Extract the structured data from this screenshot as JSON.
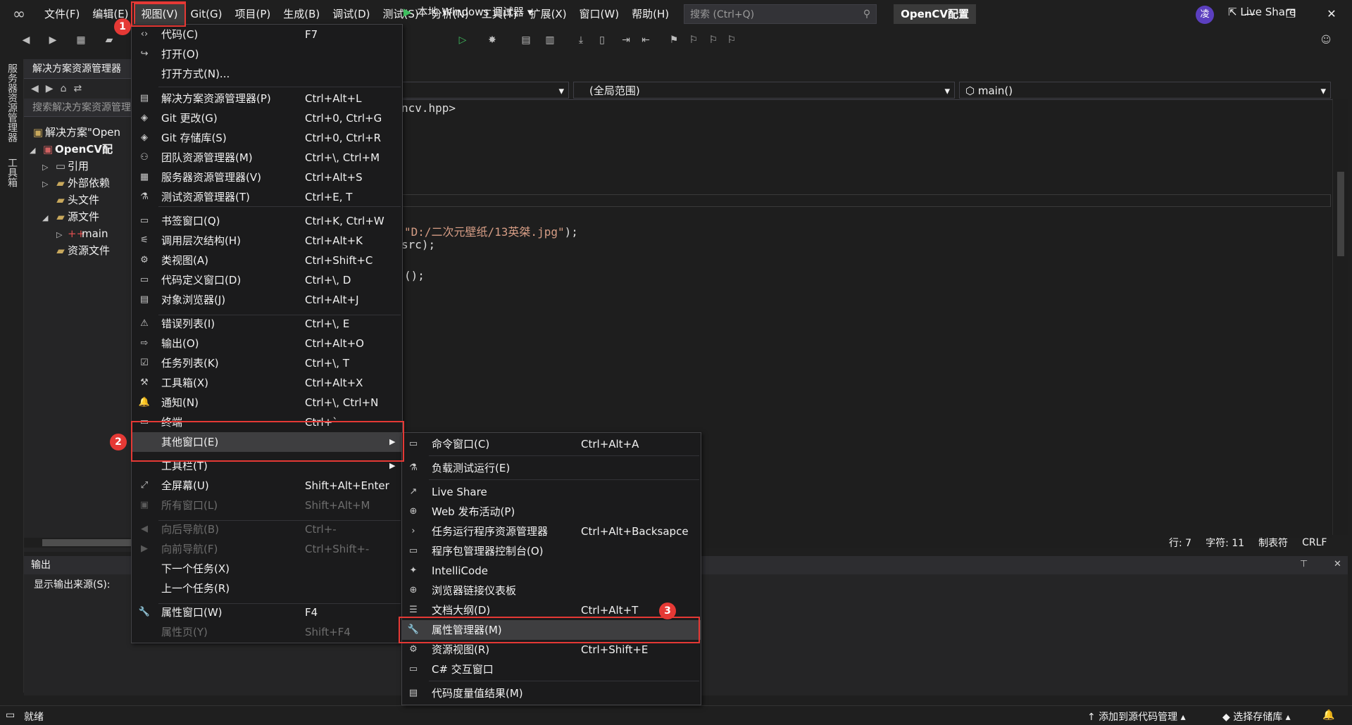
{
  "menubar": {
    "items": [
      "文件(F)",
      "编辑(E)",
      "视图(V)",
      "Git(G)",
      "项目(P)",
      "生成(B)",
      "调试(D)",
      "测试(S)",
      "分析(N)",
      "工具(T)",
      "扩展(X)",
      "窗口(W)",
      "帮助(H)"
    ],
    "search_placeholder": "搜索 (Ctrl+Q)",
    "project_name": "OpenCV配置",
    "avatar_initial": "凌"
  },
  "toolbar": {
    "debugger_label": "本地 Windows 调试器",
    "live_share": "Live Share"
  },
  "left_strip": {
    "tab1": "服务器资源管理器",
    "tab2": "工具箱"
  },
  "solution_explorer": {
    "title": "解决方案资源管理器",
    "search_placeholder": "搜索解决方案资源管理",
    "tree": [
      {
        "label": "解决方案\"Open",
        "bold": false
      },
      {
        "label": "OpenCV配",
        "bold": true
      },
      {
        "label": "引用",
        "bold": false
      },
      {
        "label": "外部依赖",
        "bold": false
      },
      {
        "label": "头文件",
        "bold": false
      },
      {
        "label": "源文件",
        "bold": false
      },
      {
        "label": "main",
        "bold": false
      },
      {
        "label": "资源文件",
        "bold": false
      }
    ]
  },
  "editor": {
    "scope_dropdown": "(全局范围)",
    "function_dropdown": "main()",
    "lines": [
      {
        "pre": "ncv.hpp>",
        "str": "",
        "post": ""
      },
      {
        "pre": "",
        "str": "\"D:/二次元壁纸/13英桀.jpg\"",
        "post": ");"
      },
      {
        "pre": "src);",
        "str": "",
        "post": ""
      },
      {
        "pre": "();",
        "str": "",
        "post": ""
      }
    ]
  },
  "status": {
    "line": "行: 7",
    "char": "字符: 11",
    "tab": "制表符",
    "eol": "CRLF",
    "ready": "就绪",
    "add_source": "添加到源代码管理",
    "select_repo": "选择存储库"
  },
  "output": {
    "title": "输出",
    "source_label": "显示输出来源(S):"
  },
  "view_menu": {
    "items": [
      {
        "icon": "‹›",
        "label": "代码(C)",
        "key": "F7",
        "disabled": false
      },
      {
        "icon": "↪",
        "label": "打开(O)",
        "key": "",
        "disabled": false
      },
      {
        "icon": "",
        "label": "打开方式(N)...",
        "key": "",
        "disabled": false
      },
      {
        "icon": "▤",
        "label": "解决方案资源管理器(P)",
        "key": "Ctrl+Alt+L",
        "disabled": false
      },
      {
        "icon": "◈",
        "label": "Git 更改(G)",
        "key": "Ctrl+0, Ctrl+G",
        "disabled": false
      },
      {
        "icon": "◈",
        "label": "Git 存储库(S)",
        "key": "Ctrl+0, Ctrl+R",
        "disabled": false
      },
      {
        "icon": "⚇",
        "label": "团队资源管理器(M)",
        "key": "Ctrl+\\, Ctrl+M",
        "disabled": false
      },
      {
        "icon": "▦",
        "label": "服务器资源管理器(V)",
        "key": "Ctrl+Alt+S",
        "disabled": false
      },
      {
        "icon": "⚗",
        "label": "测试资源管理器(T)",
        "key": "Ctrl+E, T",
        "disabled": false
      },
      {
        "icon": "▭",
        "label": "书签窗口(Q)",
        "key": "Ctrl+K, Ctrl+W",
        "disabled": false
      },
      {
        "icon": "⚟",
        "label": "调用层次结构(H)",
        "key": "Ctrl+Alt+K",
        "disabled": false
      },
      {
        "icon": "⚙",
        "label": "类视图(A)",
        "key": "Ctrl+Shift+C",
        "disabled": false
      },
      {
        "icon": "▭",
        "label": "代码定义窗口(D)",
        "key": "Ctrl+\\, D",
        "disabled": false
      },
      {
        "icon": "▤",
        "label": "对象浏览器(J)",
        "key": "Ctrl+Alt+J",
        "disabled": false
      },
      {
        "icon": "⚠",
        "label": "错误列表(I)",
        "key": "Ctrl+\\, E",
        "disabled": false
      },
      {
        "icon": "⇨",
        "label": "输出(O)",
        "key": "Ctrl+Alt+O",
        "disabled": false
      },
      {
        "icon": "☑",
        "label": "任务列表(K)",
        "key": "Ctrl+\\, T",
        "disabled": false
      },
      {
        "icon": "⚒",
        "label": "工具箱(X)",
        "key": "Ctrl+Alt+X",
        "disabled": false
      },
      {
        "icon": "🔔",
        "label": "通知(N)",
        "key": "Ctrl+\\, Ctrl+N",
        "disabled": false
      },
      {
        "icon": "▭",
        "label": "终端",
        "key": "Ctrl+`",
        "disabled": false
      },
      {
        "icon": "",
        "label": "其他窗口(E)",
        "key": "",
        "disabled": false
      },
      {
        "icon": "",
        "label": "工具栏(T)",
        "key": "",
        "disabled": false
      },
      {
        "icon": "⤢",
        "label": "全屏幕(U)",
        "key": "Shift+Alt+Enter",
        "disabled": false
      },
      {
        "icon": "▣",
        "label": "所有窗口(L)",
        "key": "Shift+Alt+M",
        "disabled": true
      },
      {
        "icon": "◀",
        "label": "向后导航(B)",
        "key": "Ctrl+-",
        "disabled": true
      },
      {
        "icon": "▶",
        "label": "向前导航(F)",
        "key": "Ctrl+Shift+-",
        "disabled": true
      },
      {
        "icon": "",
        "label": "下一个任务(X)",
        "key": "",
        "disabled": false
      },
      {
        "icon": "",
        "label": "上一个任务(R)",
        "key": "",
        "disabled": false
      },
      {
        "icon": "🔧",
        "label": "属性窗口(W)",
        "key": "F4",
        "disabled": false
      },
      {
        "icon": "",
        "label": "属性页(Y)",
        "key": "Shift+F4",
        "disabled": true
      }
    ]
  },
  "other_windows_menu": {
    "items": [
      {
        "icon": "▭",
        "label": "命令窗口(C)",
        "key": "Ctrl+Alt+A"
      },
      {
        "icon": "⚗",
        "label": "负载测试运行(E)",
        "key": ""
      },
      {
        "icon": "↗",
        "label": "Live Share",
        "key": ""
      },
      {
        "icon": "⊕",
        "label": "Web 发布活动(P)",
        "key": ""
      },
      {
        "icon": "›",
        "label": "任务运行程序资源管理器",
        "key": "Ctrl+Alt+Backsapce"
      },
      {
        "icon": "▭",
        "label": "程序包管理器控制台(O)",
        "key": ""
      },
      {
        "icon": "✦",
        "label": "IntelliCode",
        "key": ""
      },
      {
        "icon": "⊕",
        "label": "浏览器链接仪表板",
        "key": ""
      },
      {
        "icon": "☰",
        "label": "文档大纲(D)",
        "key": "Ctrl+Alt+T"
      },
      {
        "icon": "🔧",
        "label": "属性管理器(M)",
        "key": ""
      },
      {
        "icon": "⚙",
        "label": "资源视图(R)",
        "key": "Ctrl+Shift+E"
      },
      {
        "icon": "▭",
        "label": "C# 交互窗口",
        "key": ""
      },
      {
        "icon": "▤",
        "label": "代码度量值结果(M)",
        "key": ""
      }
    ]
  },
  "annotations": {
    "step1": "1",
    "step2": "2",
    "step3": "3"
  },
  "colors": {
    "accent_red": "#e53935",
    "menu_bg": "#1b1b1c",
    "highlight": "#3e3e40",
    "string": "#d69d85"
  }
}
